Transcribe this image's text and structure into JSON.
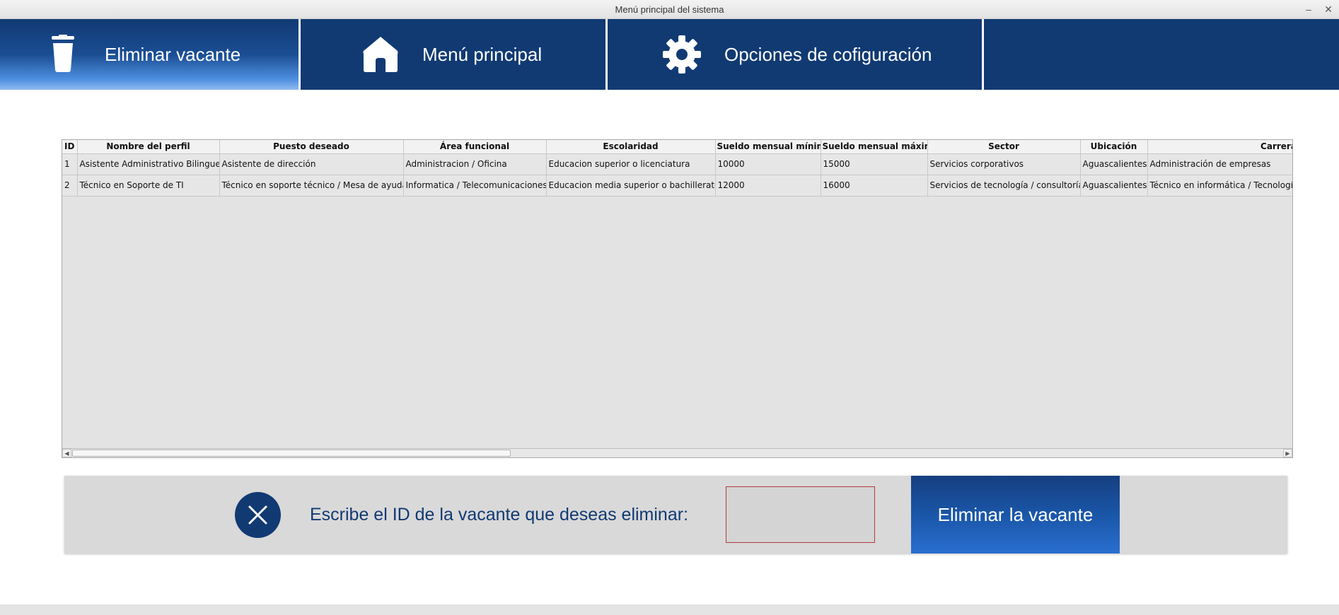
{
  "window": {
    "title": "Menú principal del sistema",
    "minimize_glyph": "–",
    "close_glyph": "✕"
  },
  "nav": {
    "items": [
      {
        "label": "Eliminar vacante",
        "icon": "trash-icon",
        "active": true
      },
      {
        "label": "Menú principal",
        "icon": "home-icon",
        "active": false
      },
      {
        "label": "Opciones de cofiguración",
        "icon": "gear-icon",
        "active": false
      }
    ]
  },
  "table": {
    "columns": [
      "ID",
      "Nombre del perfil",
      "Puesto deseado",
      "Área funcional",
      "Escolaridad",
      "Sueldo mensual mínimo",
      "Sueldo mensual máximo",
      "Sector",
      "Ubicación",
      "Carrera"
    ],
    "rows": [
      [
        "1",
        "Asistente Administrativo Bilingue",
        "Asistente de dirección",
        "Administracion / Oficina",
        "Educacion superior o licenciatura",
        "10000",
        "15000",
        "Servicios corporativos",
        "Aguascalientes",
        "Administración de empresas"
      ],
      [
        "2",
        "Técnico en Soporte de TI",
        "Técnico en soporte técnico / Mesa de ayuda",
        "Informatica / Telecomunicaciones",
        "Educacion media superior o bachillerato",
        "12000",
        "16000",
        "Servicios de tecnología / consultoría",
        "Aguascalientes",
        "Técnico en informática / Tecnologías de la información"
      ]
    ]
  },
  "delete_panel": {
    "prompt": "Escribe el ID de la vacante que deseas eliminar:",
    "input_value": "",
    "button_label": "Eliminar la vacante"
  },
  "colors": {
    "brand_navy": "#113a73",
    "button_blue": "#1a56a8",
    "input_border": "#b33b3b"
  }
}
